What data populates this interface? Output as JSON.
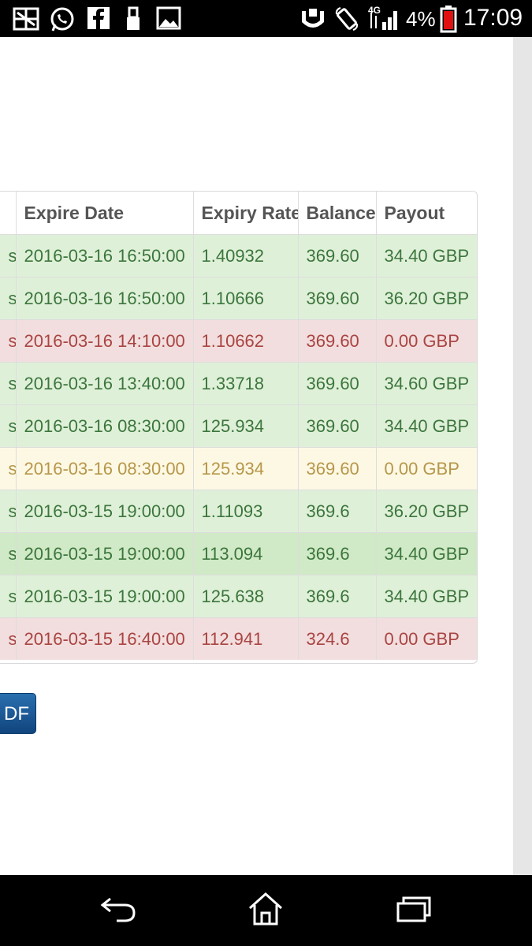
{
  "status_bar": {
    "battery_percent": "4%",
    "time": "17:09",
    "network": "4G",
    "icons": [
      "photo-grid-icon",
      "whatsapp-icon",
      "facebook-icon",
      "usb-icon",
      "image-icon",
      "nfc-icon",
      "rotate-icon",
      "signal-icon",
      "battery-icon"
    ]
  },
  "table": {
    "columns": [
      "Expire Date",
      "Expiry Rate",
      "Balance",
      "Payout"
    ],
    "rows": [
      {
        "stub": "s",
        "expire_date": "2016-03-16 16:50:00",
        "expiry_rate": "1.40932",
        "balance": "369.60",
        "payout": "34.40 GBP",
        "status": "success"
      },
      {
        "stub": "s",
        "expire_date": "2016-03-16 16:50:00",
        "expiry_rate": "1.10666",
        "balance": "369.60",
        "payout": "36.20 GBP",
        "status": "success"
      },
      {
        "stub": "s",
        "expire_date": "2016-03-16 14:10:00",
        "expiry_rate": "1.10662",
        "balance": "369.60",
        "payout": "0.00 GBP",
        "status": "danger"
      },
      {
        "stub": "s",
        "expire_date": "2016-03-16 13:40:00",
        "expiry_rate": "1.33718",
        "balance": "369.60",
        "payout": "34.60 GBP",
        "status": "success"
      },
      {
        "stub": "s",
        "expire_date": "2016-03-16 08:30:00",
        "expiry_rate": "125.934",
        "balance": "369.60",
        "payout": "34.40 GBP",
        "status": "success"
      },
      {
        "stub": "s",
        "expire_date": "2016-03-16 08:30:00",
        "expiry_rate": "125.934",
        "balance": "369.60",
        "payout": "0.00 GBP",
        "status": "warning"
      },
      {
        "stub": "s",
        "expire_date": "2016-03-15 19:00:00",
        "expiry_rate": "1.11093",
        "balance": "369.6",
        "payout": "36.20 GBP",
        "status": "success"
      },
      {
        "stub": "s",
        "expire_date": "2016-03-15 19:00:00",
        "expiry_rate": "113.094",
        "balance": "369.6",
        "payout": "34.40 GBP",
        "status": "success-dark"
      },
      {
        "stub": "s",
        "expire_date": "2016-03-15 19:00:00",
        "expiry_rate": "125.638",
        "balance": "369.6",
        "payout": "34.40 GBP",
        "status": "success"
      },
      {
        "stub": "s",
        "expire_date": "2016-03-15 16:40:00",
        "expiry_rate": "112.941",
        "balance": "324.6",
        "payout": "0.00 GBP",
        "status": "danger"
      }
    ]
  },
  "pdf_button": {
    "label": "DF"
  },
  "nav_bar": {
    "icons": [
      "back-icon",
      "home-icon",
      "recent-apps-icon"
    ]
  },
  "colors": {
    "success_bg": "#dff0d8",
    "success_text": "#3c763d",
    "danger_bg": "#f2dede",
    "danger_text": "#a94442",
    "warning_bg": "#fcf8e3",
    "warning_text": "#b7964a",
    "button": "#1a5596"
  }
}
